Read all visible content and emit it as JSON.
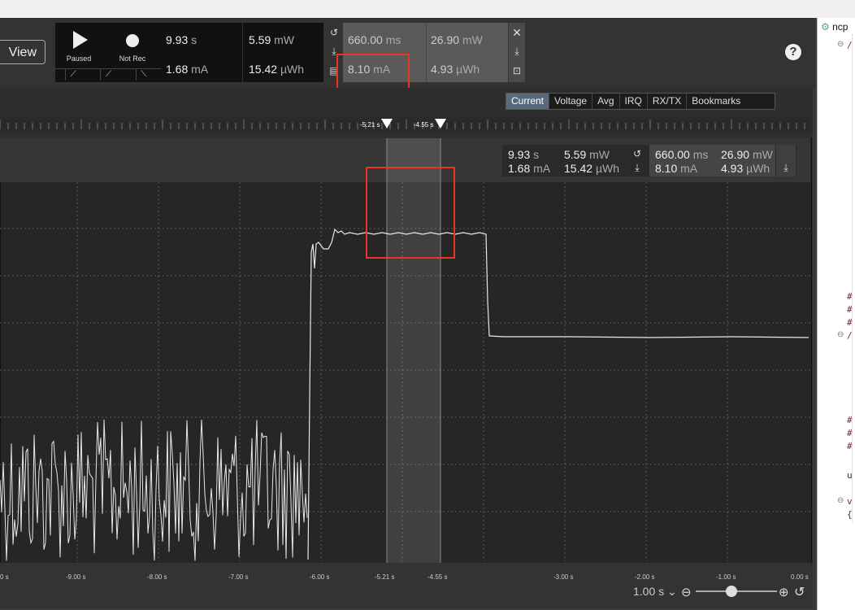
{
  "toolbar": {
    "view_label": "View",
    "play_label": "Paused",
    "record_label": "Not Rec",
    "window": {
      "duration": "9.93",
      "duration_unit": "s",
      "power": "5.59",
      "power_unit": "mW",
      "current": "1.68",
      "current_unit": "mA",
      "energy": "15.42",
      "energy_unit": "µWh"
    },
    "selection": {
      "duration": "660.00",
      "duration_unit": "ms",
      "power": "26.90",
      "power_unit": "mW",
      "current": "8.10",
      "current_unit": "mA",
      "energy": "4.93",
      "energy_unit": "µWh"
    },
    "help_label": "?"
  },
  "tabs": [
    "Current",
    "Voltage",
    "Avg",
    "IRQ",
    "RX/TX",
    "Bookmarks"
  ],
  "cursors": [
    "-5.21 s",
    "-4.55 s"
  ],
  "overlay": {
    "duration": "9.93",
    "duration_unit": "s",
    "power": "5.59",
    "power_unit": "mW",
    "current": "1.68",
    "current_unit": "mA",
    "energy": "15.42",
    "energy_unit": "µWh",
    "sel_duration": "660.00",
    "sel_duration_unit": "ms",
    "sel_power": "26.90",
    "sel_power_unit": "mW",
    "sel_current": "8.10",
    "sel_current_unit": "mA",
    "sel_energy": "4.93",
    "sel_energy_unit": "µWh"
  },
  "xaxis_ticks": [
    "0 s",
    "-9.00 s",
    "-8.00 s",
    "-7.00 s",
    "-6.00 s",
    "-5.21 s",
    "-4.55 s",
    "-3.00 s",
    "-2.00 s",
    "-1.00 s",
    "0.00 s"
  ],
  "zoom": {
    "scale": "1.00 s"
  },
  "rightpane": {
    "tab_label": "ncp",
    "lines": [
      "/",
      "#",
      "#",
      "#",
      "/",
      "#",
      "#",
      "#",
      "u",
      "v",
      "{"
    ]
  }
}
